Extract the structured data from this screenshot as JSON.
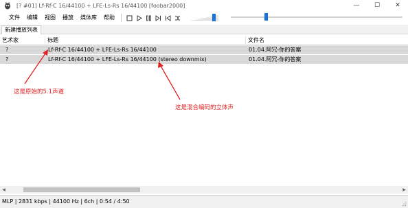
{
  "window": {
    "title": "[? #01] Lf-Rf-C 16/44100 + LFE-Ls-Rs 16/44100  [foobar2000]",
    "buttons": {
      "minimize": "—",
      "maximize": "☐",
      "close": "✕"
    }
  },
  "menu": [
    "文件",
    "编辑",
    "视图",
    "播放",
    "媒体库",
    "帮助"
  ],
  "playback_buttons": [
    "stop-icon",
    "play-icon",
    "pause-icon",
    "next-icon",
    "previous-icon",
    "random-icon"
  ],
  "volume": {
    "level": 0.78
  },
  "seek": {
    "position": 0.2
  },
  "playlist_tab": "新建播放列表",
  "columns": [
    "艺术家",
    "标题",
    "文件名"
  ],
  "rows": [
    {
      "artist": "?",
      "title": "Lf-Rf-C 16/44100 + LFE-Ls-Rs 16/44100",
      "filename": "01.04.阿冗-你的答案"
    },
    {
      "artist": "?",
      "title": "Lf-Rf-C 16/44100 + LFE-Ls-Rs 16/44100 (stereo downmix)",
      "filename": "01.04.阿冗-你的答案"
    }
  ],
  "annotations": {
    "original": "这是原始的5.1声道",
    "mixed": "这是混合编码的立体声"
  },
  "colors": {
    "annotation": "#e02020",
    "selection": "#d9d9d9",
    "accent": "#1a73d9"
  },
  "statusbar": {
    "text": "MLP | 2831 kbps | 44100 Hz | 6ch | 0:54 / 4:50"
  }
}
